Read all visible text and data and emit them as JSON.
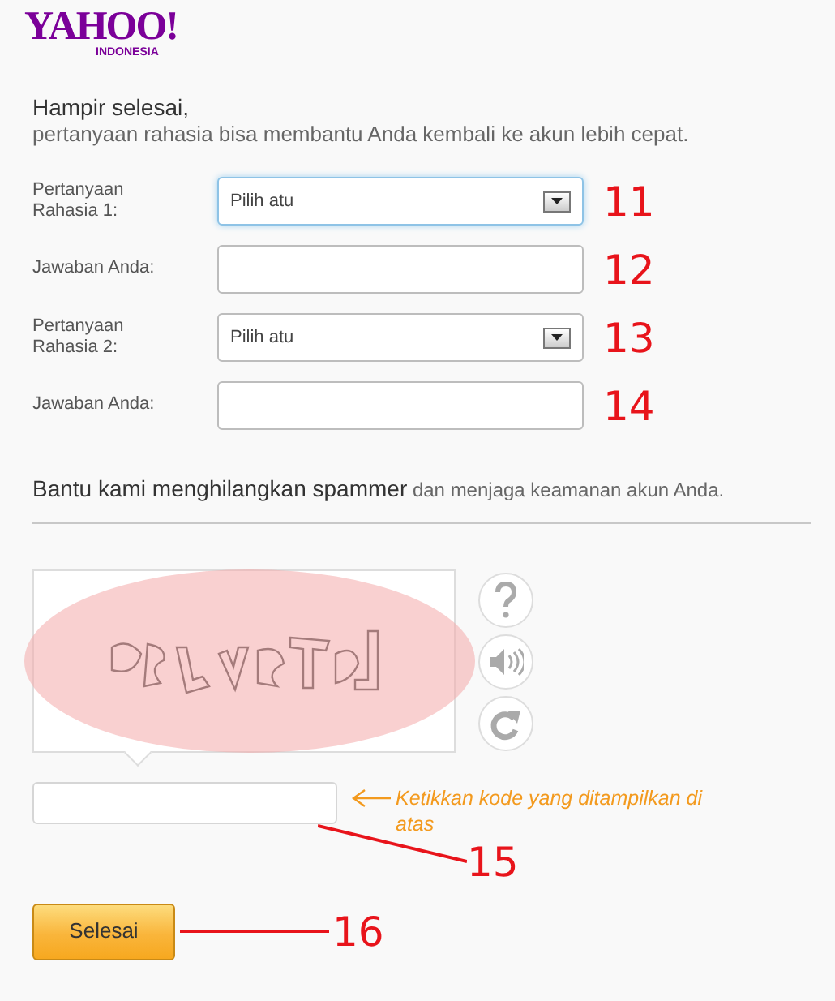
{
  "logo": {
    "wordmark": "YAHOO!",
    "region": "INDONESIA"
  },
  "intro": {
    "title": "Hampir selesai,",
    "subtitle": "pertanyaan rahasia bisa membantu Anda kembali ke akun lebih cepat."
  },
  "fields": [
    {
      "kind": "select",
      "label": "Pertanyaan Rahasia 1:",
      "value": "Pilih atu",
      "focused": true,
      "annotation": "11"
    },
    {
      "kind": "text",
      "label": "Jawaban Anda:",
      "focused": false,
      "annotation": "12"
    },
    {
      "kind": "select",
      "label": "Pertanyaan Rahasia 2:",
      "value": "Pilih atu",
      "focused": false,
      "annotation": "13"
    },
    {
      "kind": "text",
      "label": "Jawaban Anda:",
      "focused": false,
      "annotation": "14"
    }
  ],
  "spam_note": {
    "lead": "Bantu kami menghilangkan spammer",
    "rest": " dan menjaga keamanan akun Anda."
  },
  "captcha": {
    "highlighted": true,
    "buttons": [
      {
        "kind": "help"
      },
      {
        "kind": "audio"
      },
      {
        "kind": "refresh"
      }
    ],
    "hint": "Ketikkan kode yang ditampilkan di atas",
    "annotation": "15"
  },
  "submit": {
    "label": "Selesai",
    "annotation": "16"
  }
}
